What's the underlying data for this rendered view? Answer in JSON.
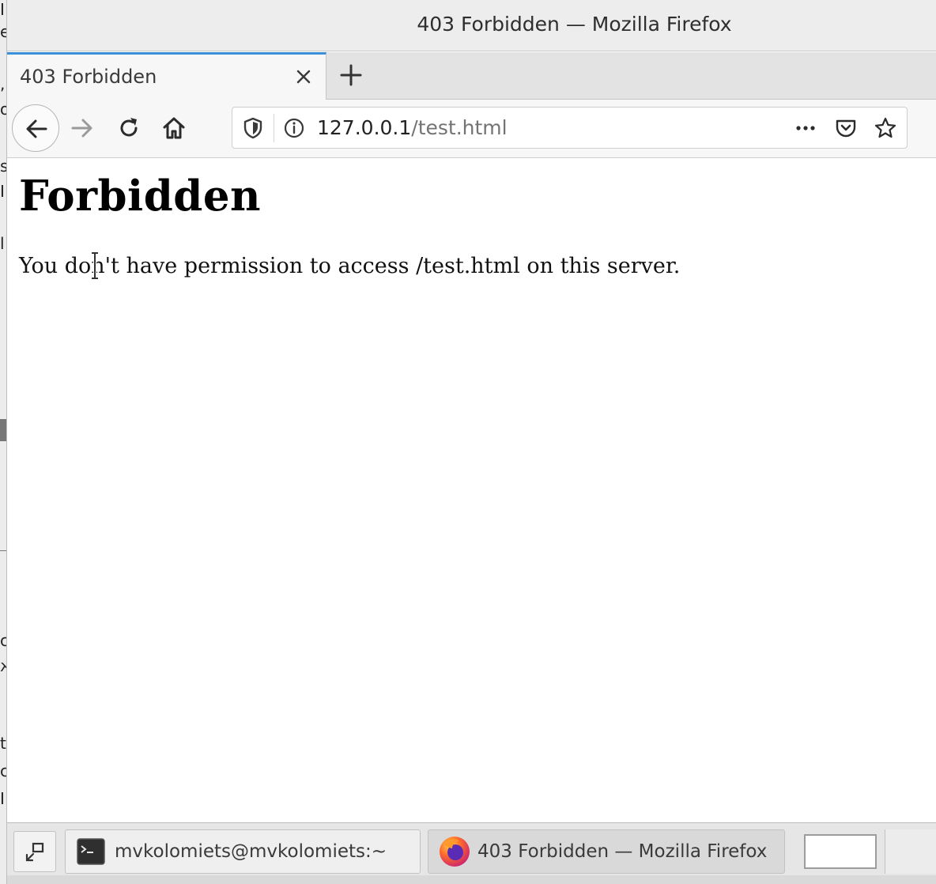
{
  "window": {
    "title": "403 Forbidden — Mozilla Firefox"
  },
  "tabs": [
    {
      "label": "403 Forbidden",
      "active": true
    }
  ],
  "navbar": {
    "url_host": "127.0.0.1",
    "url_path": "/test.html"
  },
  "page": {
    "heading": "Forbidden",
    "message": "You don't have permission to access /test.html on this server."
  },
  "taskbar": {
    "items": [
      {
        "label": "mvkolomiets@mvkolomiets:~",
        "icon": "terminal-icon",
        "active": false
      },
      {
        "label": "403 Forbidden — Mozilla Firefox",
        "icon": "firefox-icon",
        "active": true
      }
    ]
  },
  "colors": {
    "tab_accent": "#3b8fd8",
    "chrome_bg": "#ededed"
  }
}
